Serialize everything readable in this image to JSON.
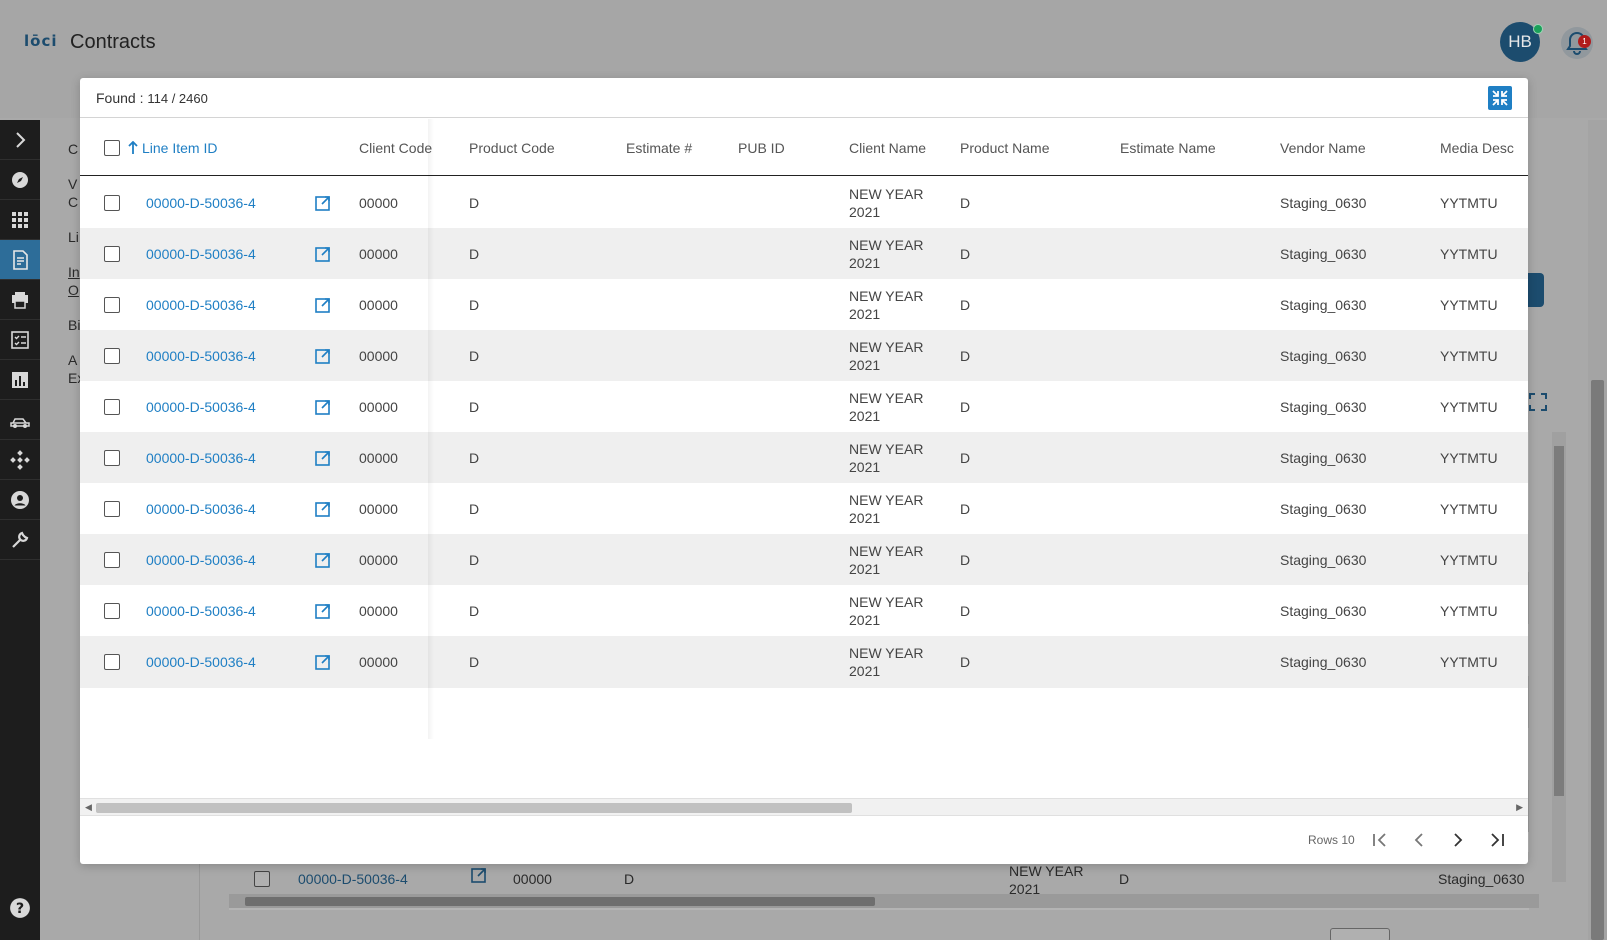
{
  "app": {
    "logo": "lōci",
    "title": "Contracts",
    "avatar_initials": "HB",
    "notification_count": "1"
  },
  "sidenav": {
    "items": [
      "expand-icon",
      "compass-icon",
      "apps-grid-icon",
      "contract-document-icon",
      "print-icon",
      "checklist-icon",
      "bar-chart-icon",
      "vehicles-icon",
      "network-icon",
      "account-icon",
      "wrench-icon"
    ],
    "active_index": 3,
    "help": "help-icon"
  },
  "background": {
    "left_panel_letters": [
      "C",
      "V",
      "C",
      "Li",
      "In",
      "O",
      "Bi",
      "A",
      "Ex"
    ],
    "visible_row": {
      "line_item_id": "00000-D-50036-4",
      "client_code": "00000",
      "product_code": "D",
      "client_name": "NEW YEAR 2021",
      "product_name": "D",
      "vendor_name": "Staging_0630"
    }
  },
  "modal": {
    "found_label": "Found :",
    "found_count": "114 / 2460",
    "columns": [
      {
        "key": "line_item_id",
        "label": "Line Item ID",
        "sorted": "asc"
      },
      {
        "key": "client_code",
        "label": "Client Code"
      },
      {
        "key": "product_code",
        "label": "Product Code"
      },
      {
        "key": "estimate_no",
        "label": "Estimate #"
      },
      {
        "key": "pub_id",
        "label": "PUB ID"
      },
      {
        "key": "client_name",
        "label": "Client Name"
      },
      {
        "key": "product_name",
        "label": "Product Name"
      },
      {
        "key": "estimate_name",
        "label": "Estimate Name"
      },
      {
        "key": "vendor_name",
        "label": "Vendor Name"
      },
      {
        "key": "media_desc",
        "label": "Media Desc"
      }
    ],
    "rows": [
      {
        "line_item_id": "00000-D-50036-4",
        "client_code": "00000",
        "product_code": "D",
        "estimate_no": "",
        "pub_id": "",
        "client_name": "NEW YEAR 2021",
        "product_name": "D",
        "estimate_name": "",
        "vendor_name": "Staging_0630",
        "media_desc": "YYTMTU"
      },
      {
        "line_item_id": "00000-D-50036-4",
        "client_code": "00000",
        "product_code": "D",
        "estimate_no": "",
        "pub_id": "",
        "client_name": "NEW YEAR 2021",
        "product_name": "D",
        "estimate_name": "",
        "vendor_name": "Staging_0630",
        "media_desc": "YYTMTU"
      },
      {
        "line_item_id": "00000-D-50036-4",
        "client_code": "00000",
        "product_code": "D",
        "estimate_no": "",
        "pub_id": "",
        "client_name": "NEW YEAR 2021",
        "product_name": "D",
        "estimate_name": "",
        "vendor_name": "Staging_0630",
        "media_desc": "YYTMTU"
      },
      {
        "line_item_id": "00000-D-50036-4",
        "client_code": "00000",
        "product_code": "D",
        "estimate_no": "",
        "pub_id": "",
        "client_name": "NEW YEAR 2021",
        "product_name": "D",
        "estimate_name": "",
        "vendor_name": "Staging_0630",
        "media_desc": "YYTMTU"
      },
      {
        "line_item_id": "00000-D-50036-4",
        "client_code": "00000",
        "product_code": "D",
        "estimate_no": "",
        "pub_id": "",
        "client_name": "NEW YEAR 2021",
        "product_name": "D",
        "estimate_name": "",
        "vendor_name": "Staging_0630",
        "media_desc": "YYTMTU"
      },
      {
        "line_item_id": "00000-D-50036-4",
        "client_code": "00000",
        "product_code": "D",
        "estimate_no": "",
        "pub_id": "",
        "client_name": "NEW YEAR 2021",
        "product_name": "D",
        "estimate_name": "",
        "vendor_name": "Staging_0630",
        "media_desc": "YYTMTU"
      },
      {
        "line_item_id": "00000-D-50036-4",
        "client_code": "00000",
        "product_code": "D",
        "estimate_no": "",
        "pub_id": "",
        "client_name": "NEW YEAR 2021",
        "product_name": "D",
        "estimate_name": "",
        "vendor_name": "Staging_0630",
        "media_desc": "YYTMTU"
      },
      {
        "line_item_id": "00000-D-50036-4",
        "client_code": "00000",
        "product_code": "D",
        "estimate_no": "",
        "pub_id": "",
        "client_name": "NEW YEAR 2021",
        "product_name": "D",
        "estimate_name": "",
        "vendor_name": "Staging_0630",
        "media_desc": "YYTMTU"
      },
      {
        "line_item_id": "00000-D-50036-4",
        "client_code": "00000",
        "product_code": "D",
        "estimate_no": "",
        "pub_id": "",
        "client_name": "NEW YEAR 2021",
        "product_name": "D",
        "estimate_name": "",
        "vendor_name": "Staging_0630",
        "media_desc": "YYTMTU"
      },
      {
        "line_item_id": "00000-D-50036-4",
        "client_code": "00000",
        "product_code": "D",
        "estimate_no": "",
        "pub_id": "",
        "client_name": "NEW YEAR 2021",
        "product_name": "D",
        "estimate_name": "",
        "vendor_name": "Staging_0630",
        "media_desc": "YYTMTU"
      }
    ],
    "footer": {
      "rows_label": "Rows 10"
    }
  },
  "colors": {
    "accent": "#1f7fc4",
    "nav_bg": "#1d1d1d",
    "nav_active": "#2d6d99",
    "avatar_bg": "#1c4c6e",
    "row_alt": "#efefef"
  }
}
